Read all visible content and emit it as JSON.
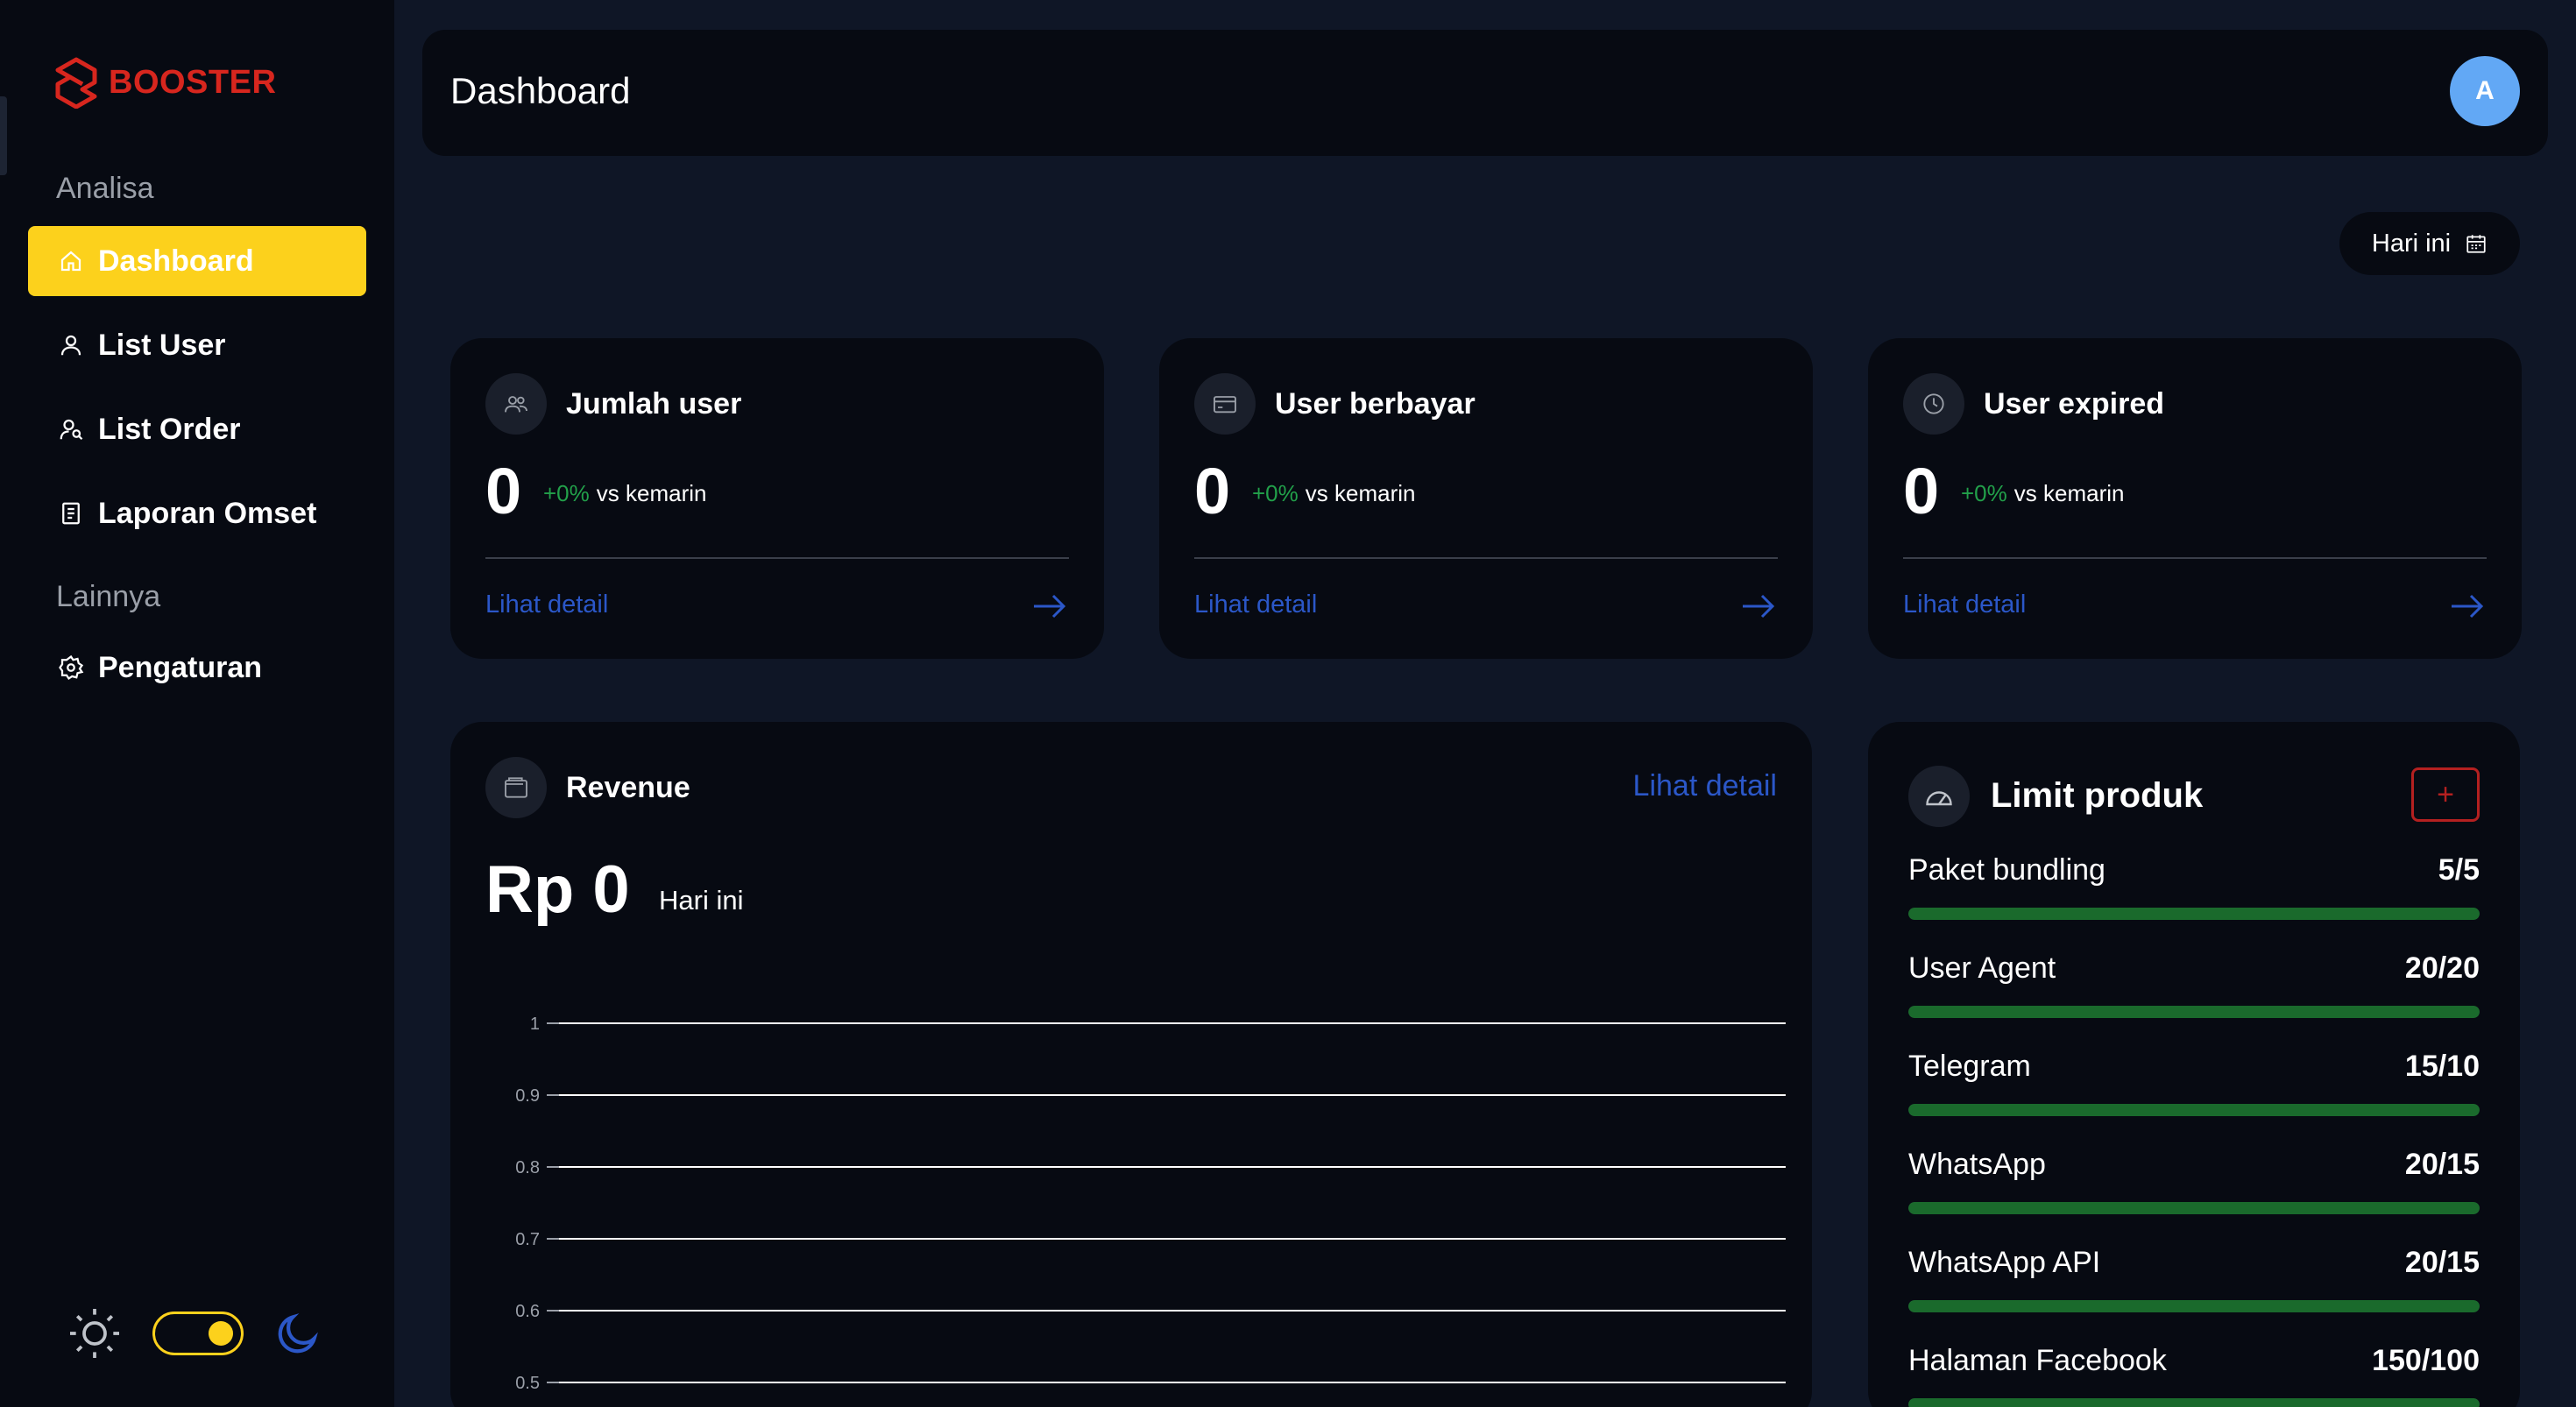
{
  "brand": {
    "name": "BOOSTER",
    "color": "#d7261e"
  },
  "sidebar": {
    "sections": [
      {
        "label": "Analisa"
      },
      {
        "label": "Lainnya"
      }
    ],
    "items": [
      {
        "label": "Dashboard",
        "icon": "home-icon",
        "active": true
      },
      {
        "label": "List User",
        "icon": "user-icon",
        "active": false
      },
      {
        "label": "List Order",
        "icon": "user-search-icon",
        "active": false
      },
      {
        "label": "Laporan Omset",
        "icon": "report-icon",
        "active": false
      },
      {
        "label": "Pengaturan",
        "icon": "gear-icon",
        "active": false
      }
    ],
    "theme": {
      "light_icon": "sun-icon",
      "dark_icon": "moon-icon",
      "dark_mode": true
    }
  },
  "header": {
    "title": "Dashboard",
    "avatar_initial": "A"
  },
  "date_filter": {
    "label": "Hari ini",
    "icon": "calendar-icon"
  },
  "stats": [
    {
      "title": "Jumlah user",
      "icon": "users-icon",
      "value": "0",
      "change": "+0%",
      "change_label": "vs kemarin",
      "link": "Lihat detail"
    },
    {
      "title": "User berbayar",
      "icon": "card-icon",
      "value": "0",
      "change": "+0%",
      "change_label": "vs kemarin",
      "link": "Lihat detail"
    },
    {
      "title": "User expired",
      "icon": "clock-icon",
      "value": "0",
      "change": "+0%",
      "change_label": "vs kemarin",
      "link": "Lihat detail"
    }
  ],
  "revenue": {
    "title": "Revenue",
    "icon": "wallet-icon",
    "link": "Lihat detail",
    "amount": "Rp 0",
    "period": "Hari ini"
  },
  "chart_data": {
    "type": "line",
    "title": "",
    "xlabel": "",
    "ylabel": "",
    "ylim": [
      0.5,
      1
    ],
    "y_ticks": [
      "1",
      "0.9",
      "0.8",
      "0.7",
      "0.6",
      "0.5"
    ],
    "grid": true,
    "series": [],
    "grid_color": "#ffffff"
  },
  "limit_produk": {
    "title": "Limit produk",
    "icon": "gauge-icon",
    "add_label": "+",
    "items": [
      {
        "name": "Paket bundling",
        "count": "5/5",
        "fill": 1.0
      },
      {
        "name": "User Agent",
        "count": "20/20",
        "fill": 1.0
      },
      {
        "name": "Telegram",
        "count": "15/10",
        "fill": 1.0
      },
      {
        "name": "WhatsApp",
        "count": "20/15",
        "fill": 1.0
      },
      {
        "name": "WhatsApp API",
        "count": "20/15",
        "fill": 1.0
      },
      {
        "name": "Halaman Facebook",
        "count": "150/100",
        "fill": 1.0
      }
    ]
  }
}
